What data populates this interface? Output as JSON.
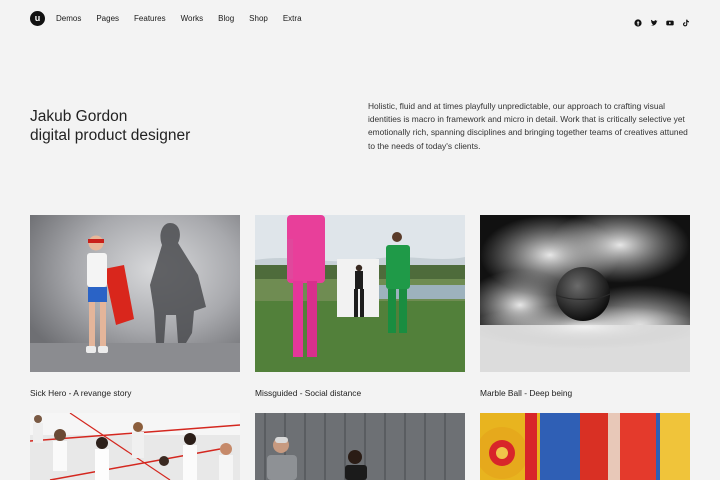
{
  "logo": {
    "letter": "u"
  },
  "nav": {
    "items": [
      "Demos",
      "Pages",
      "Features",
      "Works",
      "Blog",
      "Shop",
      "Extra"
    ]
  },
  "social": [
    "facebook-icon",
    "twitter-icon",
    "youtube-icon",
    "tiktok-icon"
  ],
  "intro": {
    "name_line1": "Jakub Gordon",
    "name_line2": "digital product designer",
    "description": "Holistic, fluid and at times playfully unpredictable, our approach to crafting visual identities is macro in framework and micro in detail. Work that is critically selective yet emotionally rich, spanning disciplines and bringing together teams of creatives attuned to the needs of today's clients."
  },
  "works": [
    {
      "caption": "Sick Hero - A revange story"
    },
    {
      "caption": "Missguided - Social distance"
    },
    {
      "caption": "Marble Ball - Deep being"
    }
  ]
}
